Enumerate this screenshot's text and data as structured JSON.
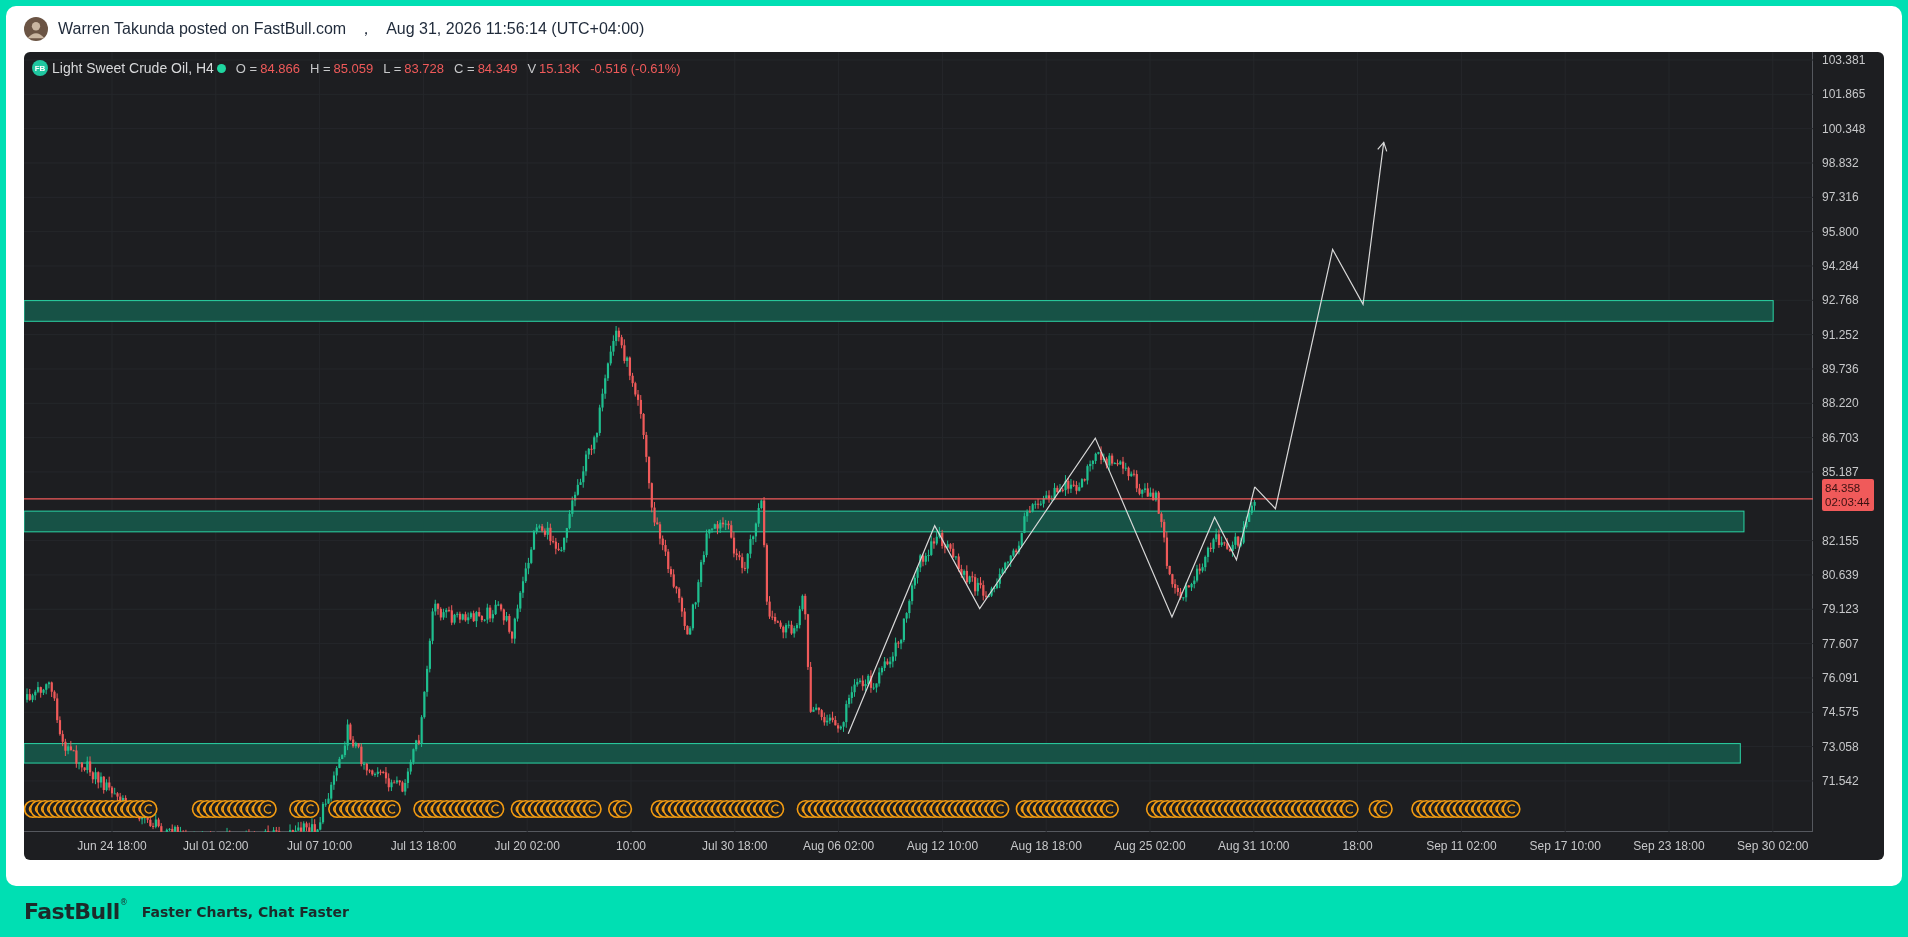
{
  "post": {
    "author_line": "Warren Takunda posted on FastBull.com",
    "separator": "，",
    "timestamp": "Aug 31, 2026 11:56:14 (UTC+04:00)"
  },
  "legend": {
    "badge": "FB",
    "title": "Light Sweet Crude Oil, H4",
    "fields": [
      {
        "label": "O =",
        "value": "84.866"
      },
      {
        "label": "H =",
        "value": "85.059"
      },
      {
        "label": "L =",
        "value": "83.728"
      },
      {
        "label": "C =",
        "value": "84.349"
      },
      {
        "label": "V",
        "value": "15.13K"
      }
    ],
    "change": "-0.516 (-0.61%)"
  },
  "price_axis": {
    "ticks": [
      "103.381",
      "101.865",
      "100.348",
      "98.832",
      "97.316",
      "95.800",
      "94.284",
      "92.768",
      "91.252",
      "89.736",
      "88.220",
      "86.703",
      "85.187",
      "82.155",
      "80.639",
      "79.123",
      "77.607",
      "76.091",
      "74.575",
      "73.058",
      "71.542"
    ],
    "last_price": {
      "price": "84.358",
      "countdown": "02:03:44"
    }
  },
  "time_axis": {
    "ticks": [
      "Jun 24 18:00",
      "Jul 01 02:00",
      "Jul 07 10:00",
      "Jul 13 18:00",
      "Jul 20 02:00",
      "10:00",
      "Jul 30 18:00",
      "Aug 06 02:00",
      "Aug 12 10:00",
      "Aug 18 18:00",
      "Aug 25 02:00",
      "Aug 31 10:00",
      "18:00",
      "Sep 11 02:00",
      "Sep 17 10:00",
      "Sep 23 18:00",
      "Sep 30 02:00"
    ]
  },
  "footer": {
    "logo": "FastBull",
    "registered": "®",
    "tagline": "Faster Charts, Chat Faster"
  }
}
